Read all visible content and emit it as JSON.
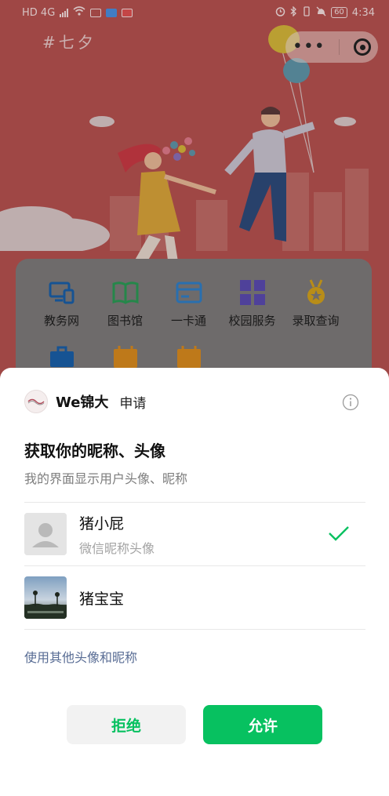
{
  "status_bar": {
    "left_text": "HD 4G",
    "battery": "60",
    "time": "4:34"
  },
  "background_page": {
    "hashtag": "#七夕",
    "grid": [
      {
        "label": "教务网",
        "icon": "monitor-phone-icon",
        "color": "#1a5fa8"
      },
      {
        "label": "图书馆",
        "icon": "book-icon",
        "color": "#2b9a55"
      },
      {
        "label": "一卡通",
        "icon": "card-icon",
        "color": "#2f7fc8"
      },
      {
        "label": "校园服务",
        "icon": "grid-squares-icon",
        "color": "#5a4ab0"
      },
      {
        "label": "录取查询",
        "icon": "medal-icon",
        "color": "#d2a11c"
      },
      {
        "label": "",
        "icon": "briefcase-icon",
        "color": "#1a5fa8"
      },
      {
        "label": "",
        "icon": "calendar-icon",
        "color": "#d98a1e"
      },
      {
        "label": "",
        "icon": "calendar-icon",
        "color": "#d98a1e"
      }
    ]
  },
  "sheet": {
    "app_name": "We锦大",
    "action": "申请",
    "title": "获取你的昵称、头像",
    "subtitle": "我的界面显示用户头像、昵称",
    "options": [
      {
        "name": "猪小屁",
        "sub": "微信昵称头像",
        "selected": true
      },
      {
        "name": "猪宝宝",
        "sub": "",
        "selected": false
      }
    ],
    "other_link": "使用其他头像和昵称",
    "reject_label": "拒绝",
    "allow_label": "允许"
  },
  "colors": {
    "accent": "#07c160",
    "link": "#586c94"
  }
}
